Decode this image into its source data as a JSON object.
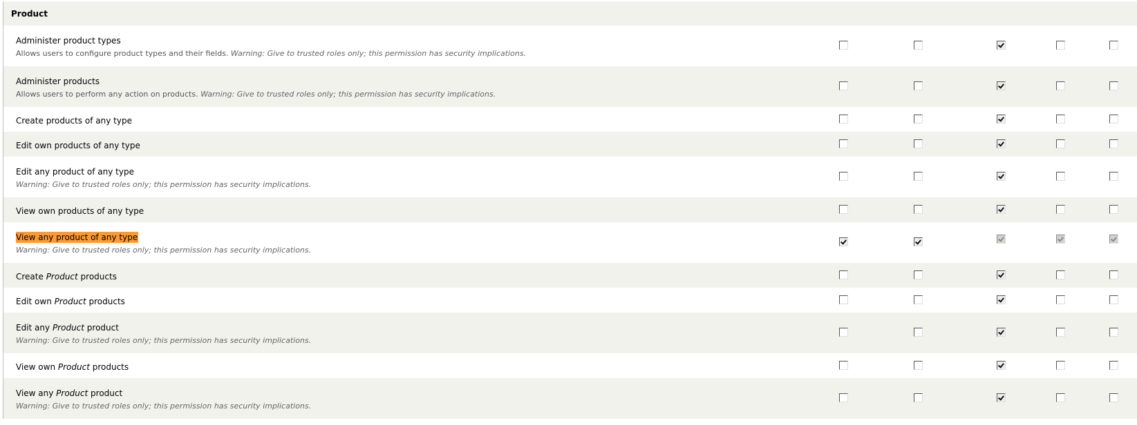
{
  "module": {
    "title": "Product"
  },
  "warning_label": "Warning: Give to trusted roles only; this permission has security implications.",
  "permissions": [
    {
      "title_pre": "Administer product types",
      "title_em": "",
      "title_post": "",
      "desc": "Allows users to configure product types and their fields.",
      "warning": true,
      "checks": [
        false,
        false,
        true,
        false,
        false
      ],
      "disabled": [
        false,
        false,
        false,
        false,
        false
      ]
    },
    {
      "title_pre": "Administer products",
      "title_em": "",
      "title_post": "",
      "desc": "Allows users to perform any action on products.",
      "warning": true,
      "checks": [
        false,
        false,
        true,
        false,
        false
      ],
      "disabled": [
        false,
        false,
        false,
        false,
        false
      ]
    },
    {
      "title_pre": "Create products of any type",
      "title_em": "",
      "title_post": "",
      "desc": "",
      "warning": false,
      "checks": [
        false,
        false,
        true,
        false,
        false
      ],
      "disabled": [
        false,
        false,
        false,
        false,
        false
      ]
    },
    {
      "title_pre": "Edit own products of any type",
      "title_em": "",
      "title_post": "",
      "desc": "",
      "warning": false,
      "checks": [
        false,
        false,
        true,
        false,
        false
      ],
      "disabled": [
        false,
        false,
        false,
        false,
        false
      ]
    },
    {
      "title_pre": "Edit any product of any type",
      "title_em": "",
      "title_post": "",
      "desc": "",
      "warning": true,
      "checks": [
        false,
        false,
        true,
        false,
        false
      ],
      "disabled": [
        false,
        false,
        false,
        false,
        false
      ]
    },
    {
      "title_pre": "View own products of any type",
      "title_em": "",
      "title_post": "",
      "desc": "",
      "warning": false,
      "checks": [
        false,
        false,
        true,
        false,
        false
      ],
      "disabled": [
        false,
        false,
        false,
        false,
        false
      ]
    },
    {
      "title_pre": "View any product of any type",
      "title_em": "",
      "title_post": "",
      "desc": "",
      "warning": true,
      "highlight": true,
      "checks": [
        true,
        true,
        true,
        true,
        true
      ],
      "disabled": [
        false,
        false,
        true,
        true,
        true
      ]
    },
    {
      "title_pre": "Create ",
      "title_em": "Product",
      "title_post": " products",
      "desc": "",
      "warning": false,
      "checks": [
        false,
        false,
        true,
        false,
        false
      ],
      "disabled": [
        false,
        false,
        false,
        false,
        false
      ]
    },
    {
      "title_pre": "Edit own ",
      "title_em": "Product",
      "title_post": " products",
      "desc": "",
      "warning": false,
      "checks": [
        false,
        false,
        true,
        false,
        false
      ],
      "disabled": [
        false,
        false,
        false,
        false,
        false
      ]
    },
    {
      "title_pre": "Edit any ",
      "title_em": "Product",
      "title_post": " product",
      "desc": "",
      "warning": true,
      "checks": [
        false,
        false,
        true,
        false,
        false
      ],
      "disabled": [
        false,
        false,
        false,
        false,
        false
      ]
    },
    {
      "title_pre": "View own ",
      "title_em": "Product",
      "title_post": " products",
      "desc": "",
      "warning": false,
      "checks": [
        false,
        false,
        true,
        false,
        false
      ],
      "disabled": [
        false,
        false,
        false,
        false,
        false
      ]
    },
    {
      "title_pre": "View any ",
      "title_em": "Product",
      "title_post": " product",
      "desc": "",
      "warning": true,
      "checks": [
        false,
        false,
        true,
        false,
        false
      ],
      "disabled": [
        false,
        false,
        false,
        false,
        false
      ]
    }
  ],
  "colors": {
    "highlight": "#ff9933",
    "row_alt": "#f2f2ed",
    "row": "#ffffff"
  }
}
